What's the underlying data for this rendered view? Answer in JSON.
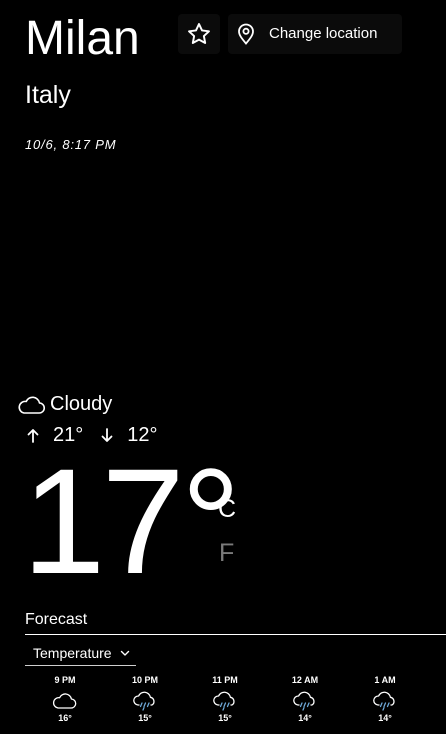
{
  "location": {
    "city": "Milan",
    "country": "Italy",
    "datetime": "10/6, 8:17 PM"
  },
  "header": {
    "favorite_icon": "star-icon",
    "change_location_icon": "map-pin-icon",
    "change_location_label": "Change location"
  },
  "current": {
    "condition": "Cloudy",
    "condition_icon": "cloud-icon",
    "high": "21°",
    "low": "12°",
    "temperature": "17°",
    "unit_celsius": "C",
    "unit_fahrenheit": "F",
    "selected_unit": "C"
  },
  "forecast": {
    "title": "Forecast",
    "metric_select": "Temperature",
    "hours": [
      {
        "time": "9 PM",
        "temp": "16°",
        "icon": "cloud-icon"
      },
      {
        "time": "10 PM",
        "temp": "15°",
        "icon": "cloud-rain-icon"
      },
      {
        "time": "11 PM",
        "temp": "15°",
        "icon": "cloud-rain-icon"
      },
      {
        "time": "12 AM",
        "temp": "14°",
        "icon": "cloud-rain-icon"
      },
      {
        "time": "1 AM",
        "temp": "14°",
        "icon": "cloud-rain-icon"
      }
    ]
  },
  "colors": {
    "background": "#000000",
    "text": "#ffffff",
    "inactive_unit": "#7a7a7a",
    "rain_drop": "#6ea8d8"
  }
}
